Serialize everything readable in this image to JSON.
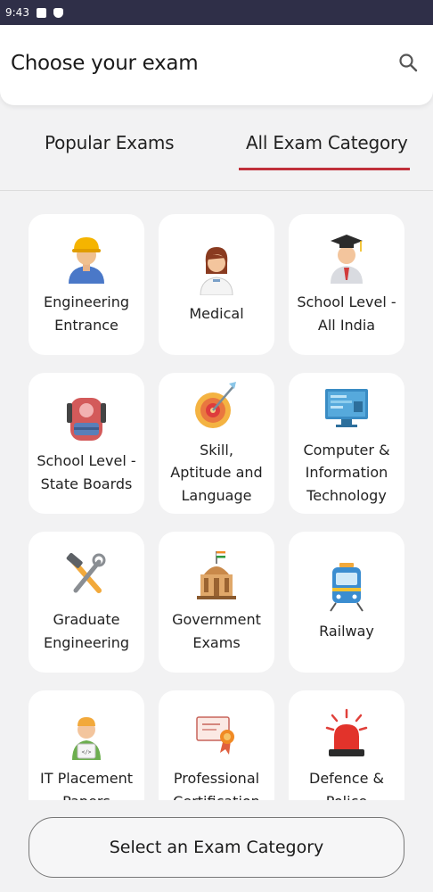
{
  "status_bar": {
    "time": "9:43"
  },
  "header": {
    "title": "Choose your exam"
  },
  "tabs": [
    {
      "label": "Popular Exams"
    },
    {
      "label": "All Exam Category"
    }
  ],
  "categories": [
    {
      "label": "Engineering\nEntrance",
      "icon": "engineer-icon"
    },
    {
      "label": "Medical",
      "icon": "doctor-icon"
    },
    {
      "label": "School Level -\nAll India",
      "icon": "graduate-icon"
    },
    {
      "label": "School Level -\nState Boards",
      "icon": "backpack-icon"
    },
    {
      "label": "Skill,\nAptitude and\nLanguage",
      "icon": "target-icon"
    },
    {
      "label": "Computer &\nInformation\nTechnology",
      "icon": "monitor-icon"
    },
    {
      "label": "Graduate\nEngineering",
      "icon": "tools-icon"
    },
    {
      "label": "Government\nExams",
      "icon": "government-building-icon"
    },
    {
      "label": "Railway",
      "icon": "train-icon"
    },
    {
      "label": "IT Placement\nPapers",
      "icon": "developer-icon"
    },
    {
      "label": "Professional\nCertification",
      "icon": "certificate-icon"
    },
    {
      "label": "Defence &\nPolice",
      "icon": "siren-icon"
    }
  ],
  "bottom_button": {
    "label": "Select an Exam Category"
  },
  "colors": {
    "accent": "#c0303a",
    "status_bar": "#2f2f48"
  }
}
